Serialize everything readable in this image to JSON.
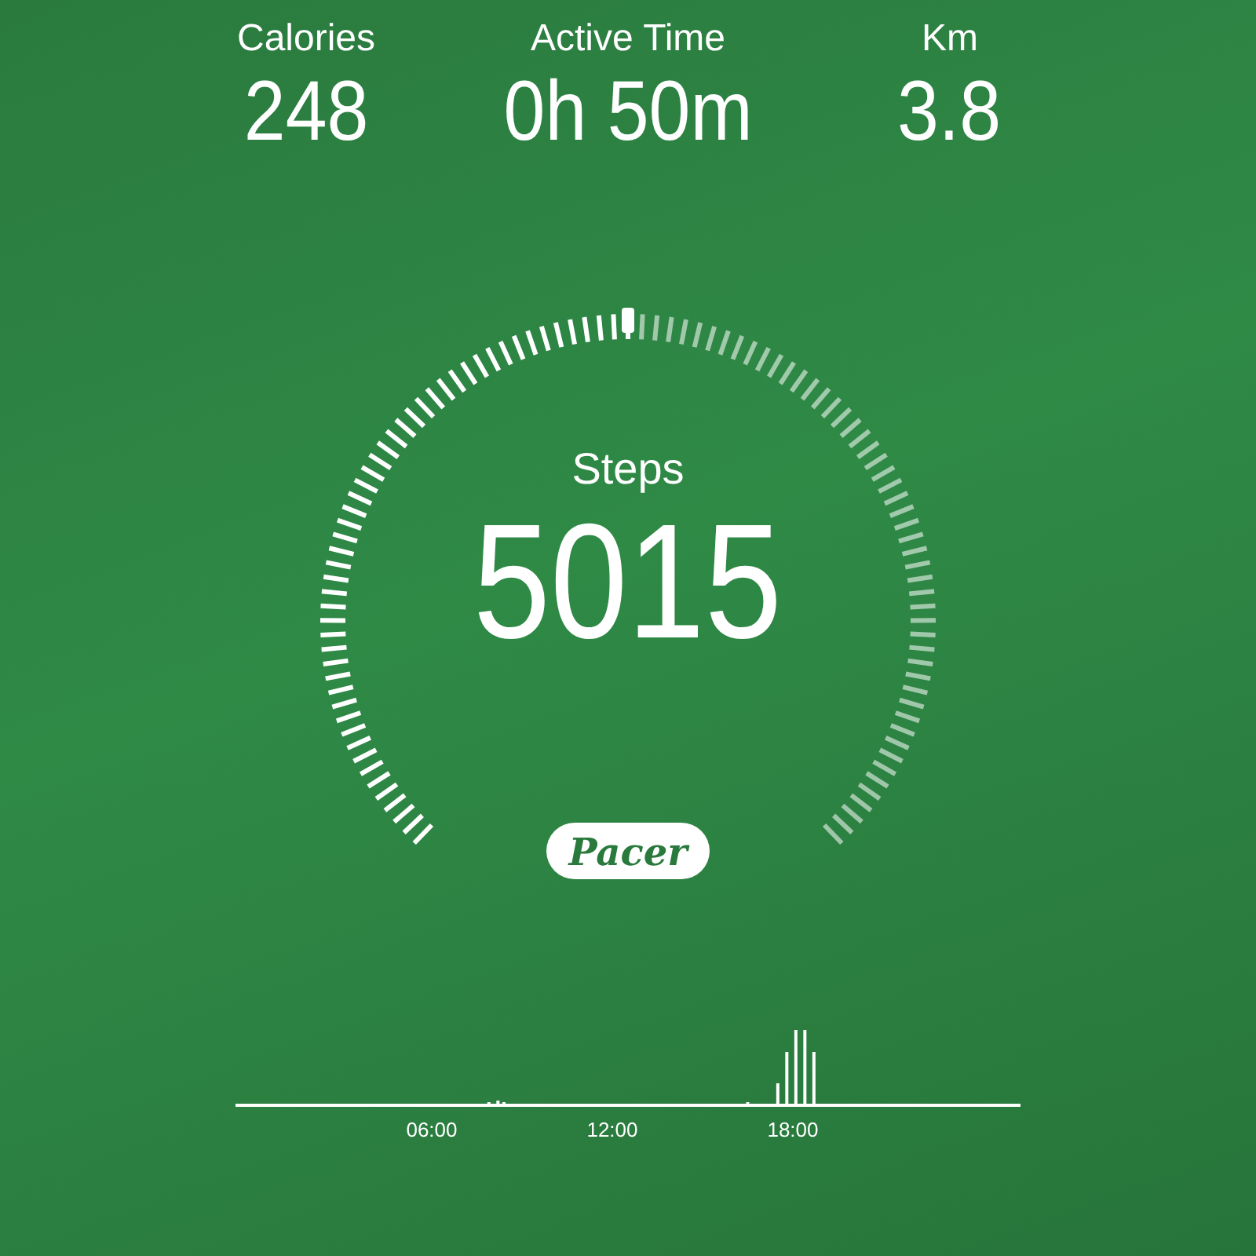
{
  "stats": [
    {
      "label": "Calories",
      "value": "248"
    },
    {
      "label": "Active Time",
      "value": "0h 50m"
    },
    {
      "label": "Km",
      "value": "3.8"
    }
  ],
  "steps": {
    "label": "Steps",
    "value": "5015"
  },
  "brand": {
    "label": "Pacer"
  },
  "activity_chart": {
    "time_labels": [
      "06:00",
      "12:00",
      "18:00"
    ]
  }
}
